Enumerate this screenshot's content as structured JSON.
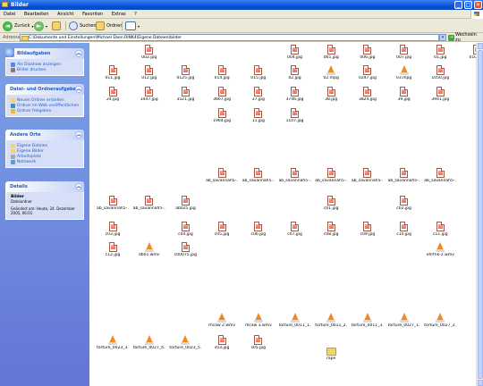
{
  "window": {
    "title": "Bilder",
    "buttons": [
      "_",
      "□",
      "✕"
    ]
  },
  "menu": [
    "Datei",
    "Bearbeiten",
    "Ansicht",
    "Favoriten",
    "Extras",
    "?"
  ],
  "toolbar": {
    "back": "Zurück",
    "search": "Suchen",
    "folders": "Ordner"
  },
  "address": {
    "label": "Adresse",
    "value": "C:\\Dokumente und Einstellungen\\Michael Eben.RINK4\\Eigene Dateien\\bilder",
    "go": "Wechseln zu"
  },
  "sidebar": {
    "picture_tasks": {
      "title": "Bildaufgaben",
      "items": [
        "Als Diashow anzeigen",
        "Bilder drucken"
      ]
    },
    "file_tasks": {
      "title": "Datei- und Ordneraufgaben",
      "items": [
        "Neuen Ordner erstellen",
        "Ordner im Web veröffentlichen",
        "Ordner freigeben"
      ]
    },
    "other_places": {
      "title": "Andere Orte",
      "items": [
        "Eigene Dateien",
        "Eigene Bilder",
        "Arbeitsplatz",
        "Netzwerk"
      ]
    },
    "details": {
      "title": "Details",
      "name": "Bilder",
      "type": "Dateiordner",
      "modified": "Geändert am: Heute, 24. Dezember 2005, 06:01"
    }
  },
  "files": [
    {
      "n": "002.jpg",
      "t": "img",
      "c": 11,
      "r": 0
    },
    {
      "n": "004.jpg",
      "t": "img",
      "c": 15,
      "r": 0
    },
    {
      "n": "005.jpg",
      "t": "img",
      "c": 16,
      "r": 0
    },
    {
      "n": "006.jpg",
      "t": "img",
      "c": 17,
      "r": 0
    },
    {
      "n": "007.jpg",
      "t": "img",
      "c": 18,
      "r": 0
    },
    {
      "n": "01.jpg",
      "t": "img",
      "c": 19,
      "r": 0
    },
    {
      "n": "010.jpg",
      "t": "img",
      "c": 20,
      "r": 0
    },
    {
      "n": "011.jpg",
      "t": "img",
      "c": 10,
      "r": 1
    },
    {
      "n": "012.jpg",
      "t": "img",
      "c": 11,
      "r": 1
    },
    {
      "n": "0125.jpg",
      "t": "img",
      "c": 12,
      "r": 1
    },
    {
      "n": "014.jpg",
      "t": "img",
      "c": 13,
      "r": 1
    },
    {
      "n": "015.jpg",
      "t": "img",
      "c": 14,
      "r": 1
    },
    {
      "n": "02.jpg",
      "t": "img",
      "c": 15,
      "r": 1
    },
    {
      "n": "02.mpg",
      "t": "cone",
      "c": 16,
      "r": 1
    },
    {
      "n": "0247.jpg",
      "t": "img",
      "c": 17,
      "r": 1
    },
    {
      "n": "03.mpg",
      "t": "cone",
      "c": 18,
      "r": 1
    },
    {
      "n": "1050.jpg",
      "t": "img",
      "c": 19,
      "r": 1
    },
    {
      "n": "24.jpg",
      "t": "img",
      "c": 10,
      "r": 2
    },
    {
      "n": "3447.jpg",
      "t": "img",
      "c": 11,
      "r": 2
    },
    {
      "n": "3521.jpg",
      "t": "img",
      "c": 12,
      "r": 2
    },
    {
      "n": "3667.jpg",
      "t": "img",
      "c": 13,
      "r": 2
    },
    {
      "n": "37.jpg",
      "t": "img",
      "c": 14,
      "r": 2
    },
    {
      "n": "3746.jpg",
      "t": "img",
      "c": 15,
      "r": 2
    },
    {
      "n": "38.jpg",
      "t": "img",
      "c": 16,
      "r": 2
    },
    {
      "n": "3824.jpg",
      "t": "img",
      "c": 17,
      "r": 2
    },
    {
      "n": "39.jpg",
      "t": "img",
      "c": 18,
      "r": 2
    },
    {
      "n": "3941.jpg",
      "t": "img",
      "c": 19,
      "r": 2
    },
    {
      "n": "1964.jpg",
      "t": "img",
      "c": 13,
      "r": 3
    },
    {
      "n": "11.jpg",
      "t": "img",
      "c": 14,
      "r": 3
    },
    {
      "n": "1107.jpg",
      "t": "img",
      "c": 15,
      "r": 3
    },
    {
      "n": "ab_savannah5-...",
      "t": "img",
      "c": 13,
      "r": 4
    },
    {
      "n": "ab_savannah5-...",
      "t": "img",
      "c": 14,
      "r": 4
    },
    {
      "n": "ab_savannah5-...",
      "t": "img",
      "c": 15,
      "r": 4
    },
    {
      "n": "ab_savannah5-...",
      "t": "img",
      "c": 16,
      "r": 4
    },
    {
      "n": "ab_savannah5-...",
      "t": "img",
      "c": 17,
      "r": 4
    },
    {
      "n": "ab_savannah5-...",
      "t": "img",
      "c": 18,
      "r": 4
    },
    {
      "n": "ab_savannah5-...",
      "t": "img",
      "c": 19,
      "r": 4
    },
    {
      "n": "ab_savannah5-...",
      "t": "img",
      "c": 10,
      "r": 5
    },
    {
      "n": "ab_savannah5-...",
      "t": "img",
      "c": 11,
      "r": 5
    },
    {
      "n": "ab025.jpg",
      "t": "img",
      "c": 12,
      "r": 5
    },
    {
      "n": "c01.jpg",
      "t": "img",
      "c": 16,
      "r": 5
    },
    {
      "n": "c02.jpg",
      "t": "img",
      "c": 18,
      "r": 5
    },
    {
      "n": "c03.jpg",
      "t": "img",
      "c": 10,
      "r": 6
    },
    {
      "n": "c04.jpg",
      "t": "img",
      "c": 12,
      "r": 6
    },
    {
      "n": "c05.jpg",
      "t": "img",
      "c": 13,
      "r": 6
    },
    {
      "n": "c06.jpg",
      "t": "img",
      "c": 14,
      "r": 6
    },
    {
      "n": "c07.jpg",
      "t": "img",
      "c": 15,
      "r": 6
    },
    {
      "n": "c08.jpg",
      "t": "img",
      "c": 16,
      "r": 6
    },
    {
      "n": "c09.jpg",
      "t": "img",
      "c": 17,
      "r": 6
    },
    {
      "n": "c10.jpg",
      "t": "img",
      "c": 18,
      "r": 6
    },
    {
      "n": "c11.jpg",
      "t": "img",
      "c": 19,
      "r": 6
    },
    {
      "n": "c12.jpg",
      "t": "img",
      "c": 10,
      "r": 7
    },
    {
      "n": "db01.wmv",
      "t": "cone",
      "c": 11,
      "r": 7
    },
    {
      "n": "c00075.jpg",
      "t": "img",
      "c": 12,
      "r": 7
    },
    {
      "n": "ehrfnk-2.wmv",
      "t": "cone",
      "c": 19,
      "r": 7
    },
    {
      "n": "rhcaw 2.wmv",
      "t": "cone",
      "c": 13,
      "r": 8
    },
    {
      "n": "rhcaw 3.wmv",
      "t": "cone",
      "c": 14,
      "r": 8
    },
    {
      "n": "torture_0011_1...",
      "t": "cone",
      "c": 15,
      "r": 8
    },
    {
      "n": "torture_0011_2...",
      "t": "cone",
      "c": 16,
      "r": 8
    },
    {
      "n": "torture_0011_3...",
      "t": "cone",
      "c": 17,
      "r": 8
    },
    {
      "n": "torture_0027_1...",
      "t": "cone",
      "c": 18,
      "r": 8
    },
    {
      "n": "torture_0027_2...",
      "t": "cone",
      "c": 19,
      "r": 8
    },
    {
      "n": "torture_0023_3...",
      "t": "cone",
      "c": 10,
      "r": 9
    },
    {
      "n": "torture_0027_4...",
      "t": "cone",
      "c": 11,
      "r": 9
    },
    {
      "n": "torture_0023_5...",
      "t": "cone",
      "c": 12,
      "r": 9
    },
    {
      "n": "s03.jpg",
      "t": "img",
      "c": 13,
      "r": 9
    },
    {
      "n": "s05.jpg",
      "t": "img",
      "c": 14,
      "r": 9
    },
    {
      "n": "rape",
      "t": "folder",
      "c": 16,
      "r": 10
    }
  ],
  "colors": {
    "titlebar": "#0a52d8",
    "sidebar": "#6f8ee0",
    "panelBody": "#d6dff7",
    "link": "#215dc6"
  }
}
